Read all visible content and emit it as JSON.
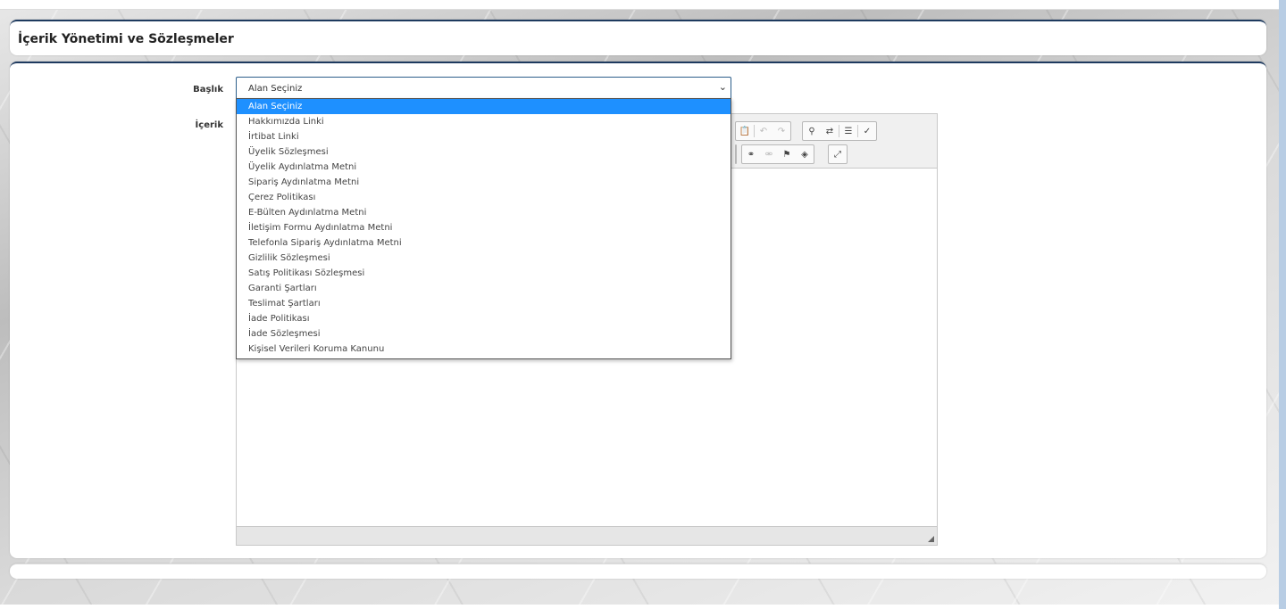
{
  "page": {
    "title": "İçerik Yönetimi ve Sözleşmeler"
  },
  "form": {
    "baslik_label": "Başlık",
    "icerik_label": "İçerik",
    "select_value": "Alan Seçiniz"
  },
  "dropdown": {
    "options": [
      "Alan Seçiniz",
      "Hakkımızda Linki",
      "İrtibat Linki",
      "Üyelik Sözleşmesi",
      "Üyelik Aydınlatma Metni",
      "Sipariş Aydınlatma Metni",
      "Çerez Politikası",
      "E-Bülten Aydınlatma Metni",
      "İletişim Formu Aydınlatma Metni",
      "Telefonla Sipariş Aydınlatma Metni",
      "Gizlilik Sözleşmesi",
      "Satış Politikası Sözleşmesi",
      "Garanti Şartları",
      "Teslimat Şartları",
      "İade Politikası",
      "İade Sözleşmesi",
      "Kişisel Verileri Koruma Kanunu"
    ],
    "selected_index": 0
  },
  "toolbar": {
    "icons": [
      "paste-icon",
      "undo-icon",
      "redo-icon",
      "find-icon",
      "replace-icon",
      "select-all-icon",
      "spellcheck-icon",
      "link-icon",
      "unlink-icon",
      "anchor-icon",
      "globe-icon",
      "maximize-icon"
    ]
  }
}
